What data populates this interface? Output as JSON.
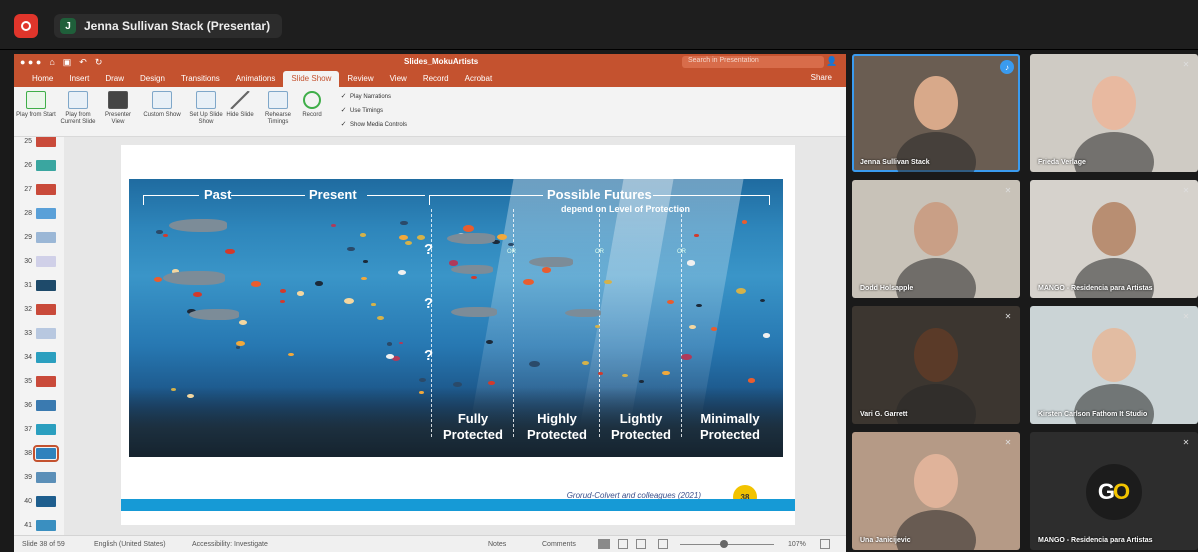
{
  "zoom": {
    "presenter_initial": "J",
    "presenter_label": "Jenna Sullivan Stack (Presentar)"
  },
  "ppt": {
    "file_name": "Slides_MokuArtists",
    "search_placeholder": "Search in Presentation",
    "tabs": [
      "Home",
      "Insert",
      "Draw",
      "Design",
      "Transitions",
      "Animations",
      "Slide Show",
      "Review",
      "View",
      "Record",
      "Acrobat"
    ],
    "active_tab": "Slide Show",
    "share_label": "Share",
    "ribbon": {
      "play_from_start": "Play from Start",
      "play_from_current": "Play from Current Slide",
      "presenter_view": "Presenter View",
      "custom_show": "Custom Show",
      "set_up_slide_show": "Set Up Slide Show",
      "hide_slide": "Hide Slide",
      "rehearse_timings": "Rehearse Timings",
      "record": "Record",
      "checks": [
        "Play Narrations",
        "Use Timings",
        "Show Media Controls"
      ]
    },
    "thumbnails": [
      {
        "num": "25",
        "color": "#c94a3a"
      },
      {
        "num": "26",
        "color": "#3aa6a0"
      },
      {
        "num": "27",
        "color": "#c94a3a"
      },
      {
        "num": "28",
        "color": "#5aa0d8"
      },
      {
        "num": "29",
        "color": "#9bb7d6"
      },
      {
        "num": "30",
        "color": "#d0d0e8"
      },
      {
        "num": "31",
        "color": "#1e4a6a"
      },
      {
        "num": "32",
        "color": "#c94a3a"
      },
      {
        "num": "33",
        "color": "#b8c8e0"
      },
      {
        "num": "34",
        "color": "#2b9fbf"
      },
      {
        "num": "35",
        "color": "#c94a3a"
      },
      {
        "num": "36",
        "color": "#3a7ab0"
      },
      {
        "num": "37",
        "color": "#2b9fbf"
      },
      {
        "num": "38",
        "color": "#2f82bd"
      },
      {
        "num": "39",
        "color": "#5b8fb8"
      },
      {
        "num": "40",
        "color": "#1e5e8e"
      },
      {
        "num": "41",
        "color": "#3a8fc0"
      }
    ],
    "selected_thumb": "38",
    "slide": {
      "past": "Past",
      "present": "Present",
      "possible_futures": "Possible Futures",
      "depend": "depend on Level of Protection",
      "or": "OR",
      "question": "?",
      "protections": [
        {
          "line1": "Fully",
          "line2": "Protected"
        },
        {
          "line1": "Highly",
          "line2": "Protected"
        },
        {
          "line1": "Lightly",
          "line2": "Protected"
        },
        {
          "line1": "Minimally",
          "line2": "Protected"
        }
      ],
      "caption": "Grorud-Colvert and colleagues (2021)",
      "number": "38"
    },
    "status": {
      "slide_of": "Slide 38 of 59",
      "language": "English (United States)",
      "accessibility": "Accessibility: Investigate",
      "notes": "Notes",
      "comments": "Comments",
      "zoom": "107%"
    }
  },
  "participants": [
    {
      "name": "Jenna Sullivan Stack",
      "speaking": true,
      "bg": "#6a5d52",
      "face": "#d8a98a"
    },
    {
      "name": "Frieda Verlage",
      "speaking": false,
      "bg": "#cfcbc4",
      "face": "#e8b9a0"
    },
    {
      "name": "Dodd Holsapple",
      "speaking": false,
      "bg": "#c8c2b8",
      "face": "#c99f86"
    },
    {
      "name": "MANGO - Residencia para Artistas",
      "speaking": false,
      "bg": "#d6d2cc",
      "face": "#b88e72"
    },
    {
      "name": "Vari G. Garrett",
      "speaking": false,
      "bg": "#3c3630",
      "face": "#5a3a28"
    },
    {
      "name": "Kirsten Carlson Fathom It Studio",
      "speaking": false,
      "bg": "#cbd4d6",
      "face": "#e2bca2"
    },
    {
      "name": "Una Janicijevic",
      "speaking": false,
      "bg": "#b59a86",
      "face": "#e0b39a"
    },
    {
      "name": "MANGO - Residencia para Artistas",
      "speaking": false,
      "bg": "#2d2d2d",
      "face": null,
      "logo": "GO"
    }
  ]
}
